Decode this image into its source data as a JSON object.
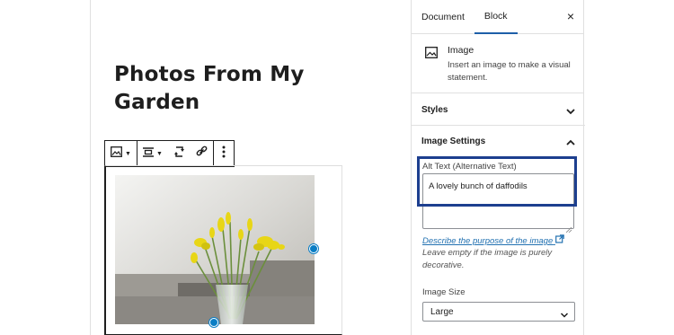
{
  "post": {
    "title": "Photos From My Garden"
  },
  "toolbar": {
    "buttons": [
      "image-block-type",
      "align",
      "replace",
      "link",
      "more-options"
    ]
  },
  "sidebar": {
    "tabs": [
      {
        "label": "Document",
        "active": false
      },
      {
        "label": "Block",
        "active": true
      }
    ],
    "close_label": "×",
    "block_card": {
      "icon": "image-icon",
      "name": "Image",
      "description": "Insert an image to make a visual statement."
    },
    "panels": {
      "styles": {
        "title": "Styles",
        "expanded": false
      },
      "image_settings": {
        "title": "Image Settings",
        "expanded": true
      }
    },
    "alt_text": {
      "label": "Alt Text (Alternative Text)",
      "value": "A lovely bunch of daffodils"
    },
    "help": {
      "link_text": "Describe the purpose of the image",
      "note": "Leave empty if the image is purely decorative."
    },
    "image_size": {
      "label": "Image Size",
      "selected": "Large"
    }
  },
  "colors": {
    "accent": "#1e5fa8",
    "highlight": "#1d3f8f",
    "handle": "#0a7dc4",
    "link": "#2271b1"
  }
}
